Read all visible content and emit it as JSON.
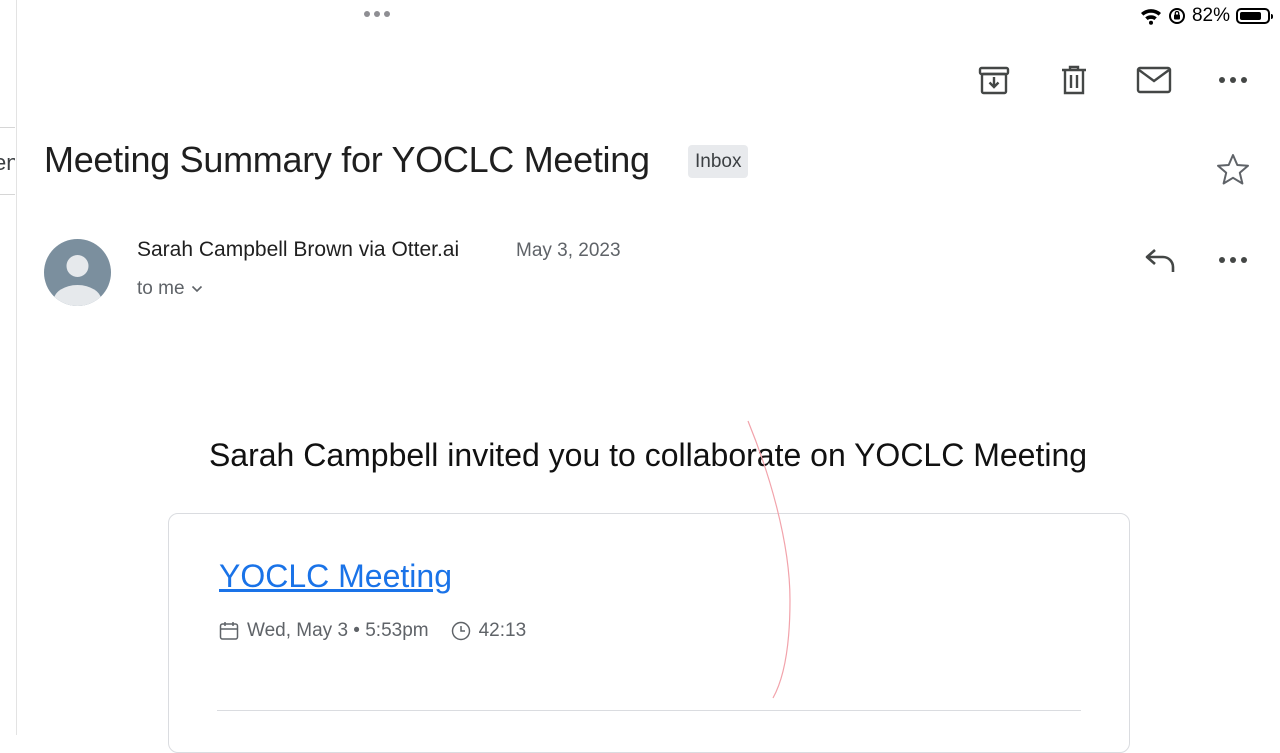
{
  "status_bar": {
    "battery_text": "82%",
    "battery_level": 0.82
  },
  "left_tab": {
    "text": "en"
  },
  "toolbar": {
    "icons": [
      "archive-icon",
      "delete-icon",
      "mark-unread-icon",
      "more-horizontal-icon"
    ]
  },
  "email": {
    "subject": "Meeting Summary for YOCLC Meeting",
    "label": "Inbox",
    "sender": "Sarah Campbell Brown via Otter.ai",
    "date": "May 3, 2023",
    "recipient": "to me"
  },
  "body": {
    "headline": "Sarah Campbell invited you to collaborate on YOCLC Meeting",
    "card": {
      "title": "YOCLC Meeting",
      "date_time": "Wed, May 3 • 5:53pm",
      "duration": "42:13"
    }
  },
  "colors": {
    "link": "#1a73e8",
    "avatar": "#7b8f9e",
    "badge_bg": "#e8eaed"
  }
}
